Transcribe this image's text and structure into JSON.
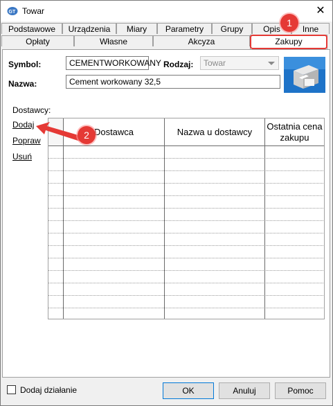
{
  "window": {
    "title": "Towar"
  },
  "tabs_row1": [
    "Podstawowe",
    "Urządzenia",
    "Miary",
    "Parametry",
    "Grupy",
    "Opis",
    "Inne"
  ],
  "tabs_row2": [
    "Opłaty",
    "Własne",
    "Akcyza",
    "Zakupy"
  ],
  "active_tab": "Zakupy",
  "form": {
    "symbol_label": "Symbol:",
    "symbol_value": "CEMENTWORKOWANY",
    "rodzaj_label": "Rodzaj:",
    "rodzaj_value": "Towar",
    "nazwa_label": "Nazwa:",
    "nazwa_value": "Cement workowany 32,5"
  },
  "suppliers": {
    "label": "Dostawcy:",
    "actions": [
      "Dodaj",
      "Popraw",
      "Usuń"
    ],
    "columns": [
      "Dostawca",
      "Nazwa u dostawcy",
      "Ostatnia cena zakupu"
    ]
  },
  "annotations": {
    "marker1": "1",
    "marker2": "2",
    "highlight_color": "#e53935"
  },
  "footer": {
    "checkbox_label": "Dodaj działanie",
    "ok": "OK",
    "cancel": "Anuluj",
    "help": "Pomoc"
  }
}
